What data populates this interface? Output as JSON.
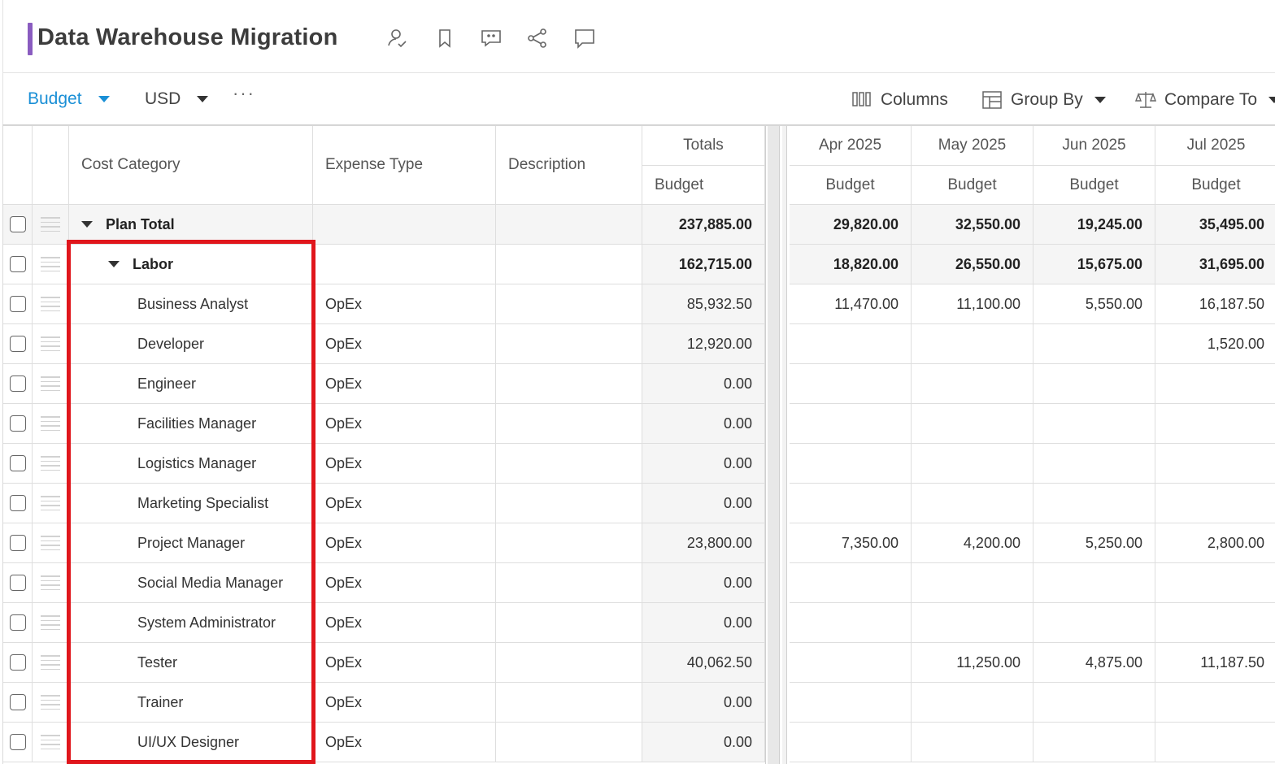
{
  "header": {
    "title": "Data Warehouse Migration",
    "icons": [
      "user-check-icon",
      "bookmark-icon",
      "comment-dots-icon",
      "share-icon",
      "comment-icon"
    ],
    "accent_color": "#8a5cc0"
  },
  "toolbar": {
    "view_label": "Budget",
    "currency_label": "USD",
    "more_label": "···",
    "columns_label": "Columns",
    "group_by_label": "Group By",
    "compare_to_label": "Compare To",
    "accent_color": "#1a8fd6"
  },
  "grid": {
    "headers": {
      "cost_category": "Cost Category",
      "expense_type": "Expense Type",
      "description": "Description",
      "totals": "Totals",
      "totals_sub": "Budget",
      "months": [
        {
          "label": "Apr 2025",
          "sub": "Budget"
        },
        {
          "label": "May 2025",
          "sub": "Budget"
        },
        {
          "label": "Jun 2025",
          "sub": "Budget"
        },
        {
          "label": "Jul 2025",
          "sub": "Budget"
        }
      ]
    },
    "rows": [
      {
        "category": "Plan Total",
        "level": 0,
        "expandable": true,
        "bold": true,
        "expense_type": "",
        "description": "",
        "total": "237,885.00",
        "months": [
          "29,820.00",
          "32,550.00",
          "19,245.00",
          "35,495.00"
        ]
      },
      {
        "category": "Labor",
        "level": 1,
        "expandable": true,
        "bold": true,
        "expense_type": "",
        "description": "",
        "total": "162,715.00",
        "months": [
          "18,820.00",
          "26,550.00",
          "15,675.00",
          "31,695.00"
        ]
      },
      {
        "category": "Business Analyst",
        "level": 2,
        "expandable": false,
        "bold": false,
        "expense_type": "OpEx",
        "description": "",
        "total": "85,932.50",
        "months": [
          "11,470.00",
          "11,100.00",
          "5,550.00",
          "16,187.50"
        ]
      },
      {
        "category": "Developer",
        "level": 2,
        "expandable": false,
        "bold": false,
        "expense_type": "OpEx",
        "description": "",
        "total": "12,920.00",
        "months": [
          "",
          "",
          "",
          "1,520.00"
        ]
      },
      {
        "category": "Engineer",
        "level": 2,
        "expandable": false,
        "bold": false,
        "expense_type": "OpEx",
        "description": "",
        "total": "0.00",
        "months": [
          "",
          "",
          "",
          ""
        ]
      },
      {
        "category": "Facilities Manager",
        "level": 2,
        "expandable": false,
        "bold": false,
        "expense_type": "OpEx",
        "description": "",
        "total": "0.00",
        "months": [
          "",
          "",
          "",
          ""
        ]
      },
      {
        "category": "Logistics Manager",
        "level": 2,
        "expandable": false,
        "bold": false,
        "expense_type": "OpEx",
        "description": "",
        "total": "0.00",
        "months": [
          "",
          "",
          "",
          ""
        ]
      },
      {
        "category": "Marketing Specialist",
        "level": 2,
        "expandable": false,
        "bold": false,
        "expense_type": "OpEx",
        "description": "",
        "total": "0.00",
        "months": [
          "",
          "",
          "",
          ""
        ]
      },
      {
        "category": "Project Manager",
        "level": 2,
        "expandable": false,
        "bold": false,
        "expense_type": "OpEx",
        "description": "",
        "total": "23,800.00",
        "months": [
          "7,350.00",
          "4,200.00",
          "5,250.00",
          "2,800.00"
        ]
      },
      {
        "category": "Social Media Manager",
        "level": 2,
        "expandable": false,
        "bold": false,
        "expense_type": "OpEx",
        "description": "",
        "total": "0.00",
        "months": [
          "",
          "",
          "",
          ""
        ]
      },
      {
        "category": "System Administrator",
        "level": 2,
        "expandable": false,
        "bold": false,
        "expense_type": "OpEx",
        "description": "",
        "total": "0.00",
        "months": [
          "",
          "",
          "",
          ""
        ]
      },
      {
        "category": "Tester",
        "level": 2,
        "expandable": false,
        "bold": false,
        "expense_type": "OpEx",
        "description": "",
        "total": "40,062.50",
        "months": [
          "",
          "11,250.00",
          "4,875.00",
          "11,187.50"
        ]
      },
      {
        "category": "Trainer",
        "level": 2,
        "expandable": false,
        "bold": false,
        "expense_type": "OpEx",
        "description": "",
        "total": "0.00",
        "months": [
          "",
          "",
          "",
          ""
        ]
      },
      {
        "category": "UI/UX Designer",
        "level": 2,
        "expandable": false,
        "bold": false,
        "expense_type": "OpEx",
        "description": "",
        "total": "0.00",
        "months": [
          "",
          "",
          "",
          ""
        ]
      }
    ],
    "highlight_color": "#e0161c"
  }
}
